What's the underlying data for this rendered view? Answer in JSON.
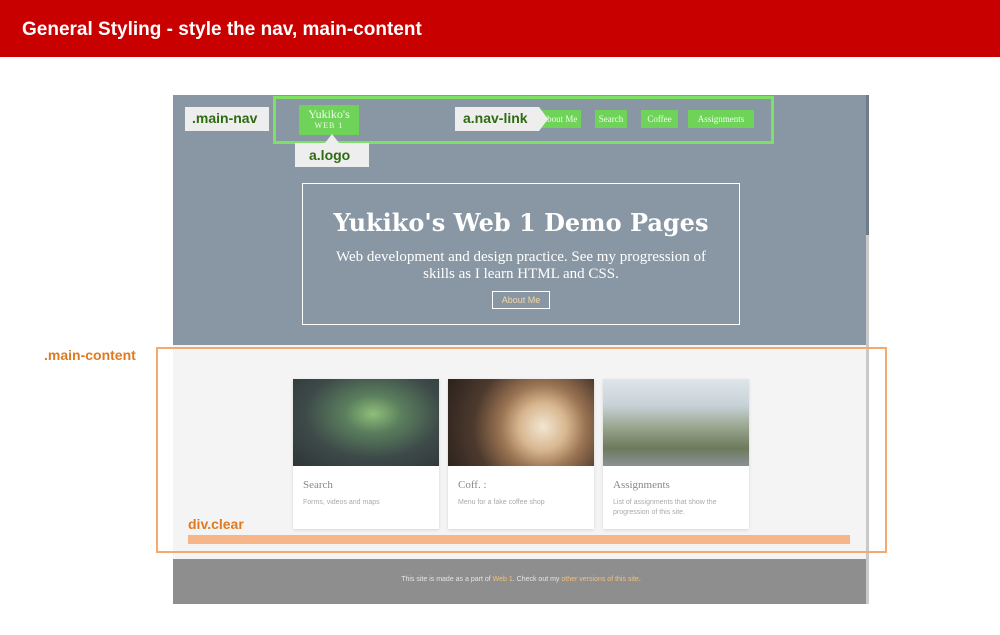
{
  "banner": {
    "title": "General Styling - style the nav, main-content"
  },
  "site": {
    "nav": {
      "logo_line1": "Yukiko's",
      "logo_line2": "WEB 1",
      "links": [
        "About Me",
        "Search",
        "Coffee",
        "Assignments"
      ]
    },
    "hero": {
      "title": "Yukiko's Web 1 Demo Pages",
      "subtitle": "Web development and design practice. See my progression of skills as I learn HTML and CSS.",
      "button": "About Me"
    },
    "cards": [
      {
        "title": "Search",
        "description": "Forms, videos and maps"
      },
      {
        "title": "Coff. :",
        "description": "Menu for a fake coffee shop"
      },
      {
        "title": "Assignments",
        "description": "List of assignments that show the progression of this site."
      }
    ],
    "footer": {
      "prefix": "This site is made as a part of ",
      "link1": "Web 1",
      "middle": ". Check out my ",
      "link2": "other versions of this site",
      "suffix": "."
    }
  },
  "annotations": {
    "main_nav": ".main-nav",
    "nav_link": "a.nav-link",
    "logo": "a.logo",
    "main_content": ".main-content",
    "div_clear": "div.clear"
  },
  "colors": {
    "banner": "#c80000",
    "hero_overlay": "#8897a3",
    "nav_highlight": "#6fd35a",
    "nav_outline": "#7fe066",
    "content_outline": "#f5a96c",
    "annotation_orange": "#e07a21",
    "annotation_green": "#2e6b12"
  }
}
